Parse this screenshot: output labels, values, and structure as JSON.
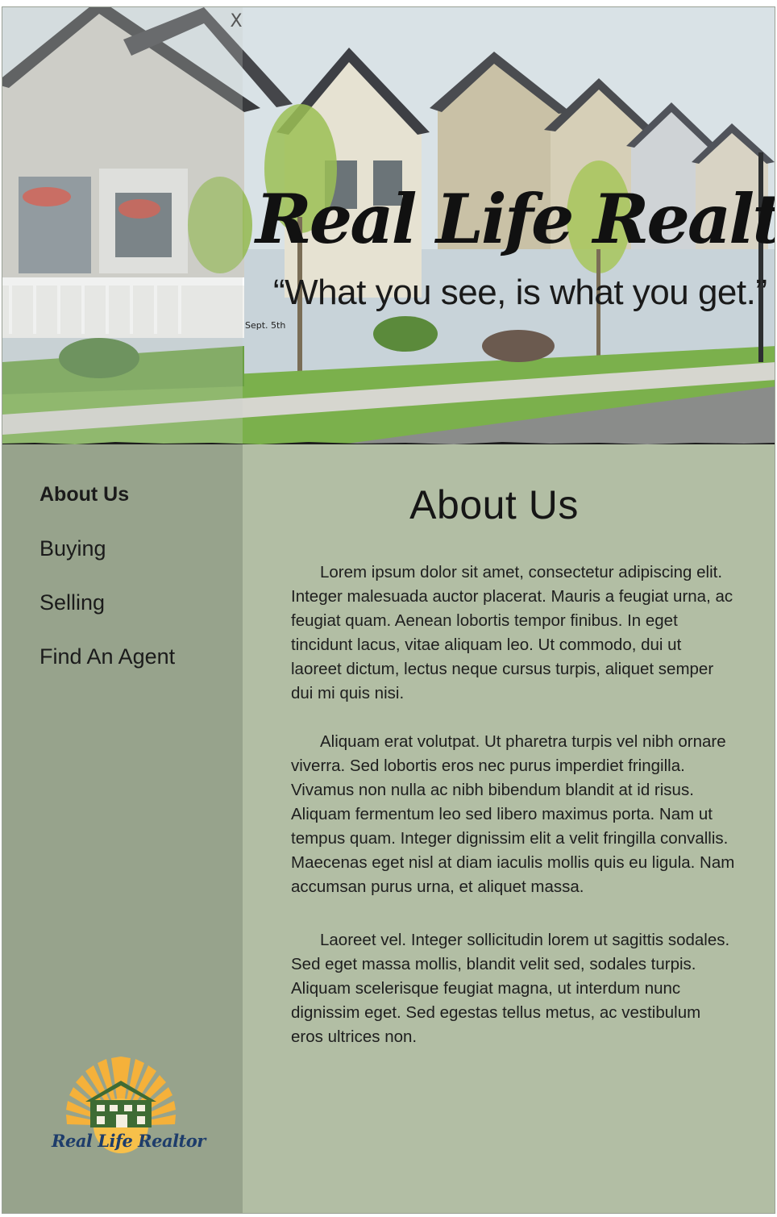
{
  "hero": {
    "brand_title": "Real Life Realtor",
    "tagline": "“What you see, is what you get.”",
    "date": "Sept. 5th",
    "close_label": "X"
  },
  "sidebar": {
    "items": [
      {
        "label": "About Us",
        "active": true
      },
      {
        "label": "Buying",
        "active": false
      },
      {
        "label": "Selling",
        "active": false
      },
      {
        "label": "Find An Agent",
        "active": false
      }
    ],
    "logo_text": "Real Life Realtor"
  },
  "main": {
    "title": "About Us",
    "paragraphs": [
      "Lorem ipsum dolor sit amet, consectetur adipiscing elit. Integer malesuada auctor placerat. Mauris a feugiat urna, ac feugiat quam. Aenean lobortis tempor finibus. In eget tincidunt lacus, vitae aliquam leo. Ut commodo, dui ut laoreet dictum, lectus neque cursus turpis, aliquet semper dui mi quis nisi.",
      "Aliquam erat volutpat. Ut pharetra turpis vel nibh ornare viverra. Sed lobortis eros nec purus imperdiet fringilla. Vivamus non nulla ac nibh bibendum blandit at id risus. Aliquam fermentum leo sed libero maximus porta. Nam ut tempus quam. Integer dignissim elit a velit fringilla convallis. Maecenas eget nisl at diam iaculis mollis quis eu ligula. Nam accumsan purus urna, et aliquet massa.",
      "Laoreet vel. Integer sollicitudin lorem ut sagittis sodales. Sed eget massa mollis, blandit velit sed, sodales turpis. Aliquam scelerisque feugiat magna, ut interdum nunc dignissim eget. Sed egestas tellus metus, ac vestibulum eros ultrices non."
    ]
  },
  "colors": {
    "sidebar_bg": "#97a38c",
    "content_bg": "#b2bea4",
    "logo_sun": "#f5b13a",
    "logo_house": "#3e6b34",
    "logo_text": "#1e3d6b"
  },
  "icons": {
    "close": "close-icon",
    "logo": "sun-house-logo-icon"
  }
}
